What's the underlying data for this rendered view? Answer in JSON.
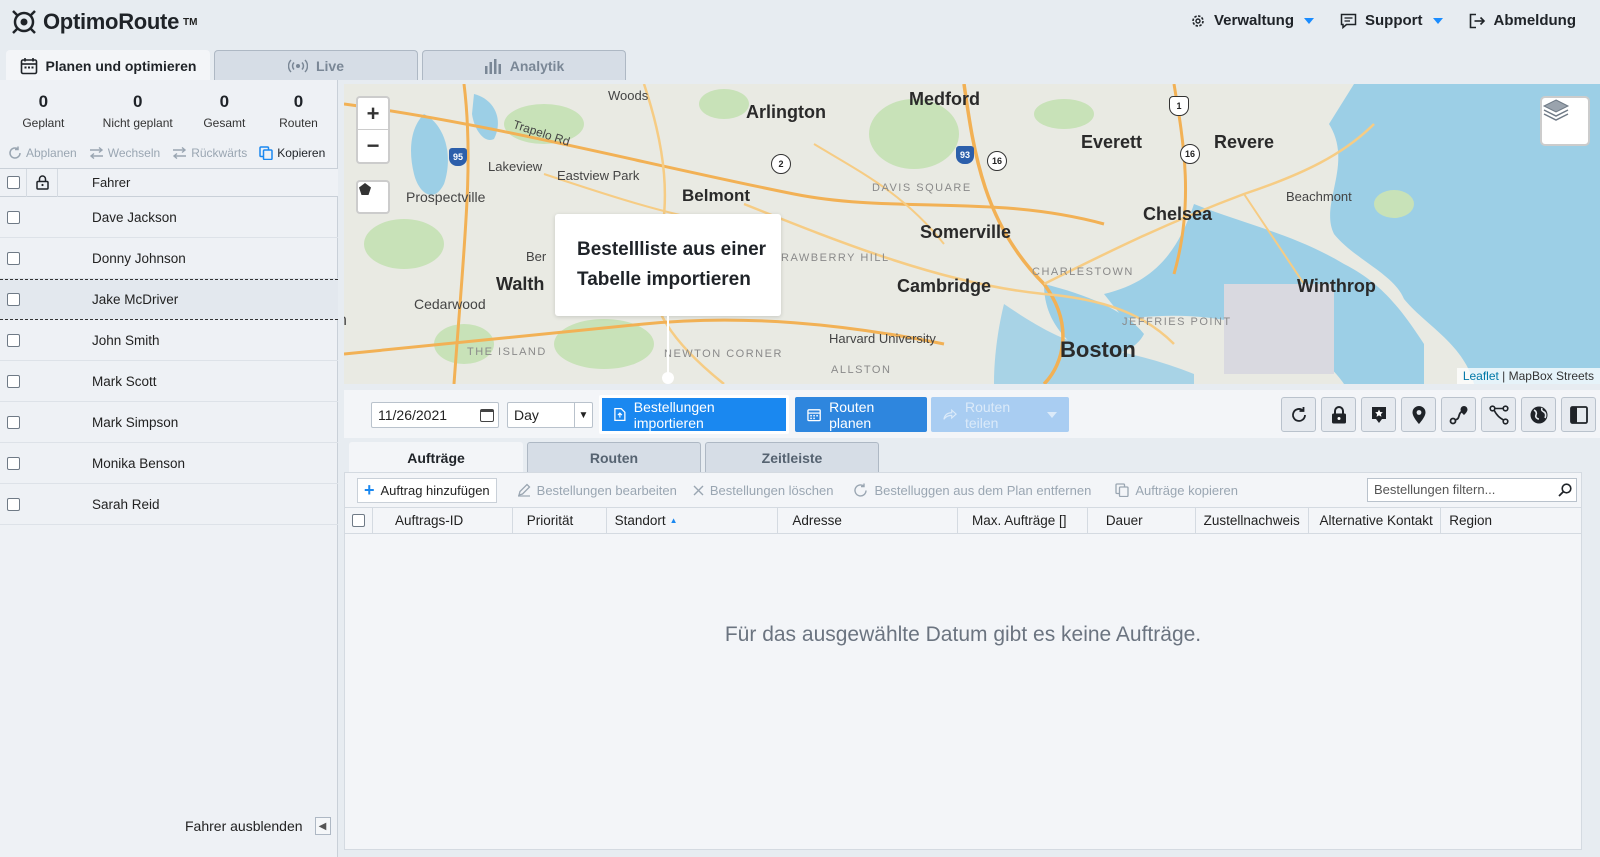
{
  "header": {
    "logo_text": "OptimoRoute",
    "logo_tm": "TM",
    "nav": [
      {
        "label": "Verwaltung",
        "icon": "gear-icon"
      },
      {
        "label": "Support",
        "icon": "chat-icon"
      },
      {
        "label": "Abmeldung",
        "icon": "logout-icon"
      }
    ]
  },
  "main_tabs": [
    {
      "label": "Planen und optimieren",
      "icon": "calendar-icon",
      "active": true
    },
    {
      "label": "Live",
      "icon": "broadcast-icon"
    },
    {
      "label": "Analytik",
      "icon": "bar-chart-icon"
    }
  ],
  "stats": [
    {
      "value": "0",
      "label": "Geplant"
    },
    {
      "value": "0",
      "label": "Nicht geplant"
    },
    {
      "value": "0",
      "label": "Gesamt"
    },
    {
      "value": "0",
      "label": "Routen"
    }
  ],
  "driver_actions": [
    {
      "label": "Abplanen",
      "enabled": false
    },
    {
      "label": "Wechseln",
      "enabled": false
    },
    {
      "label": "Rückwärts",
      "enabled": false
    },
    {
      "label": "Kopieren",
      "enabled": true
    }
  ],
  "drivers_header": "Fahrer",
  "drivers": [
    "Dave Jackson",
    "Donny Johnson",
    "Jake McDriver",
    "John Smith",
    "Mark Scott",
    "Mark Simpson",
    "Monika Benson",
    "Sarah Reid"
  ],
  "hide_drivers_label": "Fahrer ausblenden",
  "map": {
    "labels": {
      "woods": "Woods",
      "arlington": "Arlington",
      "medford": "Medford",
      "everett": "Everett",
      "revere": "Revere",
      "trapelo": "Trapelo Rd",
      "lakeview": "Lakeview",
      "eastview": "Eastview Park",
      "belmont": "Belmont",
      "davis": "DAVIS SQUARE",
      "prospectville": "Prospectville",
      "somerville": "Somerville",
      "chelsea": "Chelsea",
      "beachmont": "Beachmont",
      "strawberry": "STRAWBERRY HILL",
      "charlestown": "CHARLESTOWN",
      "waltham": "Walth",
      "ber": "Ber",
      "cambridge": "Cambridge",
      "winthrop": "Winthrop",
      "cedarwood": "Cedarwood",
      "jeffries": "JEFFRIES POINT",
      "harvard": "Harvard University",
      "boston": "Boston",
      "island": "THE ISLAND",
      "newton": "NEWTON CORNER",
      "allston": "ALLSTON",
      "n": "n"
    },
    "shields": [
      "95",
      "2",
      "93",
      "16",
      "16",
      "1"
    ],
    "attribution_link": "Leaflet",
    "attribution_text": " | MapBox Streets",
    "zoom_in": "+",
    "zoom_out": "−"
  },
  "tooltip": {
    "line1": "Bestellliste aus einer",
    "line2": "Tabelle importieren"
  },
  "toolbar": {
    "date": "11/26/2021",
    "view": "Day",
    "import_label": "Bestellungen importieren",
    "plan_label": "Routen planen",
    "share_label": "Routen teilen",
    "icon_buttons": [
      "refresh-icon",
      "lock-icon",
      "star-pin-icon",
      "location-pin-icon",
      "route-icon",
      "route-split-icon",
      "globe-icon",
      "panel-icon"
    ]
  },
  "sub_tabs": [
    {
      "label": "Aufträge",
      "active": true
    },
    {
      "label": "Routen"
    },
    {
      "label": "Zeitleiste"
    }
  ],
  "orders": {
    "add_label": "Auftrag hinzufügen",
    "edit_label": "Bestellungen bearbeiten",
    "delete_label": "Bestellungen löschen",
    "remove_label": "Bestelluggen aus dem Plan entfernen",
    "copy_label": "Aufträge kopieren",
    "filter_placeholder": "Bestellungen filtern...",
    "columns": [
      "Auftrags-ID",
      "Priorität",
      "Standort",
      "Adresse",
      "Max. Aufträge []",
      "Dauer",
      "Zustellnachweis",
      "Alternative Kontakt",
      "Region"
    ],
    "sorted_column": "Standort",
    "empty_message": "Für das ausgewählte Datum gibt es keine Aufträge."
  },
  "colors": {
    "accent": "#1a88f0",
    "water": "#9ccfe6",
    "land": "#e9eae3",
    "park": "#c8e2b8",
    "road": "#f2b155"
  }
}
